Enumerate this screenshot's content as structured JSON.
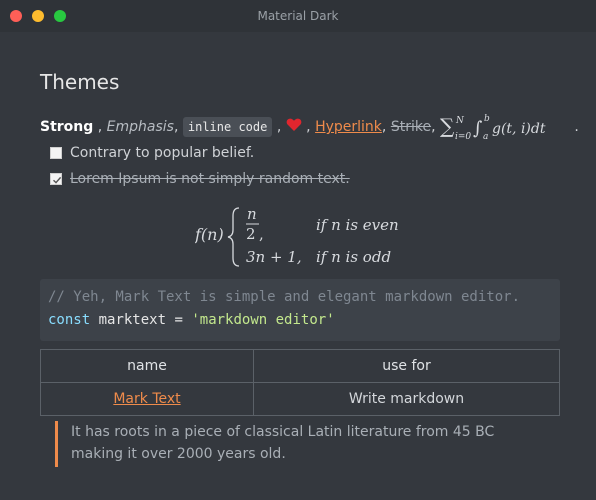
{
  "window": {
    "title": "Material Dark"
  },
  "doc": {
    "heading": "Themes",
    "inline": {
      "strong": "Strong",
      "emphasis": "Emphasis",
      "code": "inline code",
      "hyperlink": "Hyperlink",
      "strike": "Strike",
      "sep": ","
    },
    "tasks": [
      {
        "label": "Contrary to popular belief.",
        "checked": false
      },
      {
        "label": "Lorem Ipsum is not simply random text.",
        "checked": true
      }
    ],
    "math_block": {
      "lhs": "f(n)",
      "case1_expr": "n/2,",
      "case1_cond": "if n is even",
      "case2_expr": "3n + 1,",
      "case2_cond": "if n is odd"
    },
    "code": {
      "comment": "// Yeh, Mark Text is simple and elegant markdown editor.",
      "keyword": "const",
      "var": "marktext",
      "op": "=",
      "string": "'markdown editor'"
    },
    "table": {
      "headers": [
        "name",
        "use for"
      ],
      "rows": [
        [
          "Mark Text",
          "Write markdown"
        ]
      ]
    },
    "quote": [
      "It has roots in a piece of classical Latin literature from 45 BC",
      "making it over 2000 years old."
    ]
  },
  "colors": {
    "accent": "#ef8b4b",
    "background": "#34383e"
  }
}
